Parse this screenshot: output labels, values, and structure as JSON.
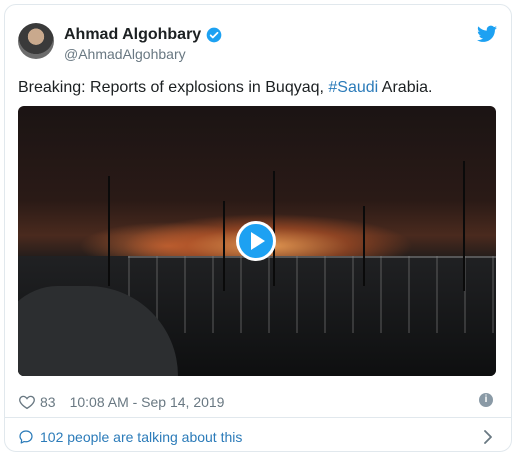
{
  "tweet": {
    "author_name": "Ahmad Algohbary",
    "author_handle": "@AhmadAlgohbary",
    "text_before": "Breaking: Reports of explosions in Buqyaq, ",
    "hashtag": "#Saudi",
    "text_after": " Arabia.",
    "like_count": "83",
    "timestamp": "10:08 AM - Sep 14, 2019",
    "info_glyph": "i",
    "talking_text": "102 people are talking about this"
  },
  "icons": {
    "verified": "verified-badge-icon",
    "brand": "twitter-bird-icon",
    "play": "play-icon",
    "like": "heart-icon",
    "info": "info-icon",
    "conversation": "speech-bubble-icon",
    "chevron": "chevron-right-icon"
  },
  "colors": {
    "accent": "#1da1f2",
    "link": "#2b7bb9",
    "muted": "#697882",
    "text": "#1c2022"
  }
}
